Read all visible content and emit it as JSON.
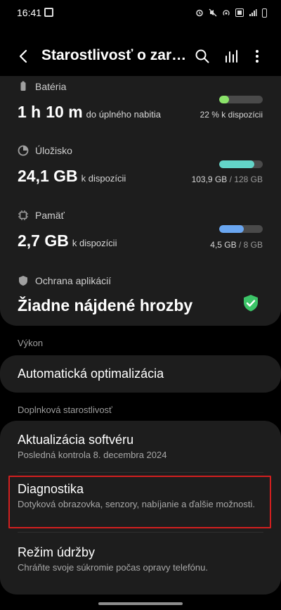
{
  "status_bar": {
    "time": "16:41"
  },
  "header": {
    "title": "Starostlivosť o zariadenie"
  },
  "battery": {
    "caption": "Batéria",
    "hours": "1 h",
    "minutes": "10 m",
    "suffix": "do úplného nabitia",
    "available": "22 % k dispozícii",
    "level": 0.22,
    "color": "#8be36a"
  },
  "storage": {
    "caption": "Úložisko",
    "value": "24,1 GB",
    "suffix": "k dispozícii",
    "used_label": "103,9 GB",
    "total_label": "/ 128 GB",
    "level": 0.81,
    "color": "#63d4c8"
  },
  "memory": {
    "caption": "Pamäť",
    "value": "2,7 GB",
    "suffix": "k dispozícii",
    "used_label": "4,5 GB",
    "total_label": "/ 8 GB",
    "level": 0.56,
    "color": "#6aa6f0"
  },
  "app_protection": {
    "caption": "Ochrana aplikácií",
    "status": "Žiadne nájdené hrozby",
    "color": "#3cc468"
  },
  "performance": {
    "section": "Výkon",
    "auto_optimization": "Automatická optimalizácia"
  },
  "additional_care": {
    "section": "Doplnková starostlivosť",
    "items": [
      {
        "title": "Aktualizácia softvéru",
        "subtitle": "Posledná kontrola 8. decembra 2024"
      },
      {
        "title": "Diagnostika",
        "subtitle": "Dotyková obrazovka, senzory, nabíjanie a ďalšie možnosti."
      },
      {
        "title": "Režim údržby",
        "subtitle": "Chráňte svoje súkromie počas opravy telefónu."
      }
    ]
  }
}
